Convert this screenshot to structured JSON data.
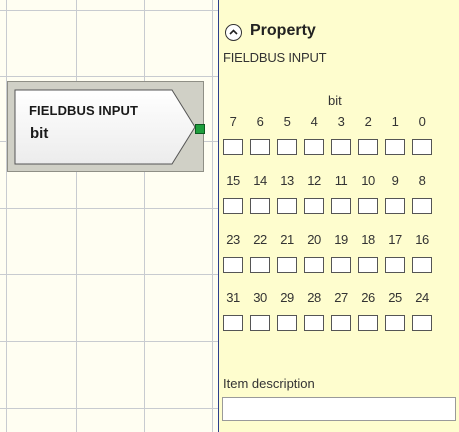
{
  "block": {
    "title": "FIELDBUS INPUT",
    "subtitle": "bit",
    "pin_color": "#1e9e3c"
  },
  "panel": {
    "title": "Property",
    "subtitle": "FIELDBUS INPUT",
    "bit_header": "bit",
    "bit_rows": [
      [
        "7",
        "6",
        "5",
        "4",
        "3",
        "2",
        "1",
        "0"
      ],
      [
        "15",
        "14",
        "13",
        "12",
        "11",
        "10",
        "9",
        "8"
      ],
      [
        "23",
        "22",
        "21",
        "20",
        "19",
        "18",
        "17",
        "16"
      ],
      [
        "31",
        "30",
        "29",
        "28",
        "27",
        "26",
        "25",
        "24"
      ]
    ],
    "description_label": "Item description",
    "description_value": ""
  },
  "colors": {
    "panel_bg": "#fefdce",
    "canvas_bg": "#fffef2",
    "divider": "#2c3f8c"
  }
}
